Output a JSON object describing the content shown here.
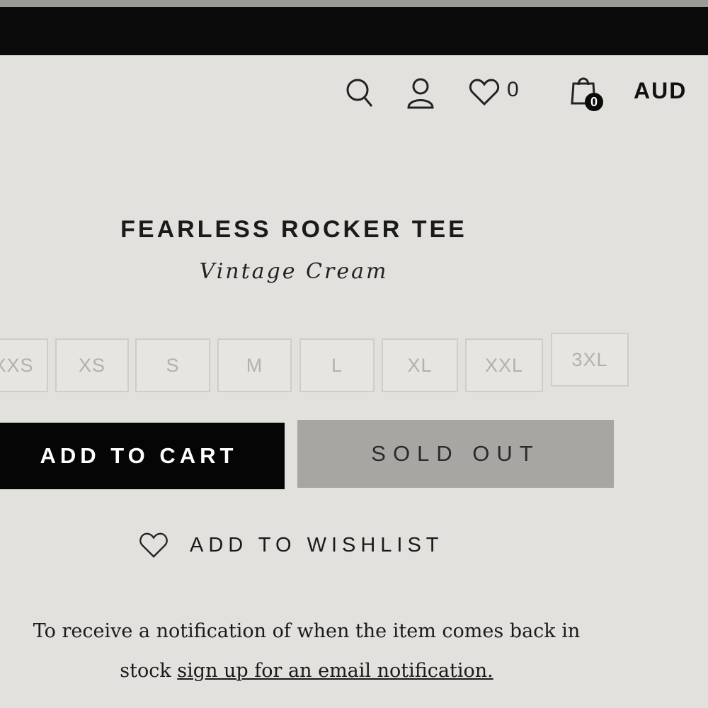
{
  "header": {
    "search_icon": "search-icon",
    "account_icon": "user-icon",
    "wishlist_icon": "heart-icon",
    "wishlist_count": "0",
    "cart_icon": "shopping-bag-icon",
    "cart_count": "0",
    "currency": "AUD"
  },
  "product": {
    "title": "FEARLESS ROCKER TEE",
    "color": "Vintage Cream",
    "sizes": [
      "XXS",
      "XS",
      "S",
      "M",
      "L",
      "XL",
      "XXL",
      "3XL"
    ]
  },
  "actions": {
    "add_to_cart": "ADD TO CART",
    "sold_out": "SOLD OUT",
    "wishlist": "ADD TO WISHLIST"
  },
  "notice": {
    "line1": "To receive a notification of when the item comes back in",
    "line2_prefix": "stock ",
    "link_text": "sign up for an email notification."
  },
  "colors": {
    "background": "#e2e1dd",
    "primary_button": "#050505",
    "disabled_button": "#a7a6a3",
    "disabled_text": "#b3b1ad"
  }
}
